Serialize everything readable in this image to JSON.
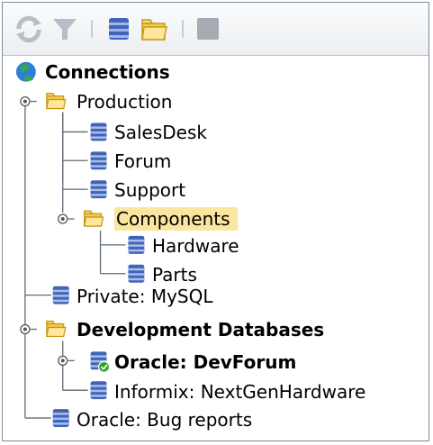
{
  "toolbar": {
    "buttons": [
      {
        "icon": "refresh-icon",
        "enabled": false
      },
      {
        "icon": "filter-icon",
        "enabled": false
      },
      {
        "icon": "database-icon",
        "enabled": true
      },
      {
        "icon": "folder-icon",
        "enabled": true
      },
      {
        "icon": "stop-icon",
        "enabled": false
      }
    ]
  },
  "tree": {
    "root": "Connections",
    "production": "Production",
    "salesdesk": "SalesDesk",
    "forum": "Forum",
    "support": "Support",
    "components": "Components",
    "hardware": "Hardware",
    "parts": "Parts",
    "private": "Private: MySQL",
    "dev": "Development Databases",
    "devforum": "Oracle: DevForum",
    "informix": "Informix: NextGenHardware",
    "bugs": "Oracle: Bug reports"
  },
  "colors": {
    "selection": "#fbe6a0",
    "folder": "#f2c94c",
    "database": "#3f64b8",
    "connected": "#2fa62f"
  }
}
